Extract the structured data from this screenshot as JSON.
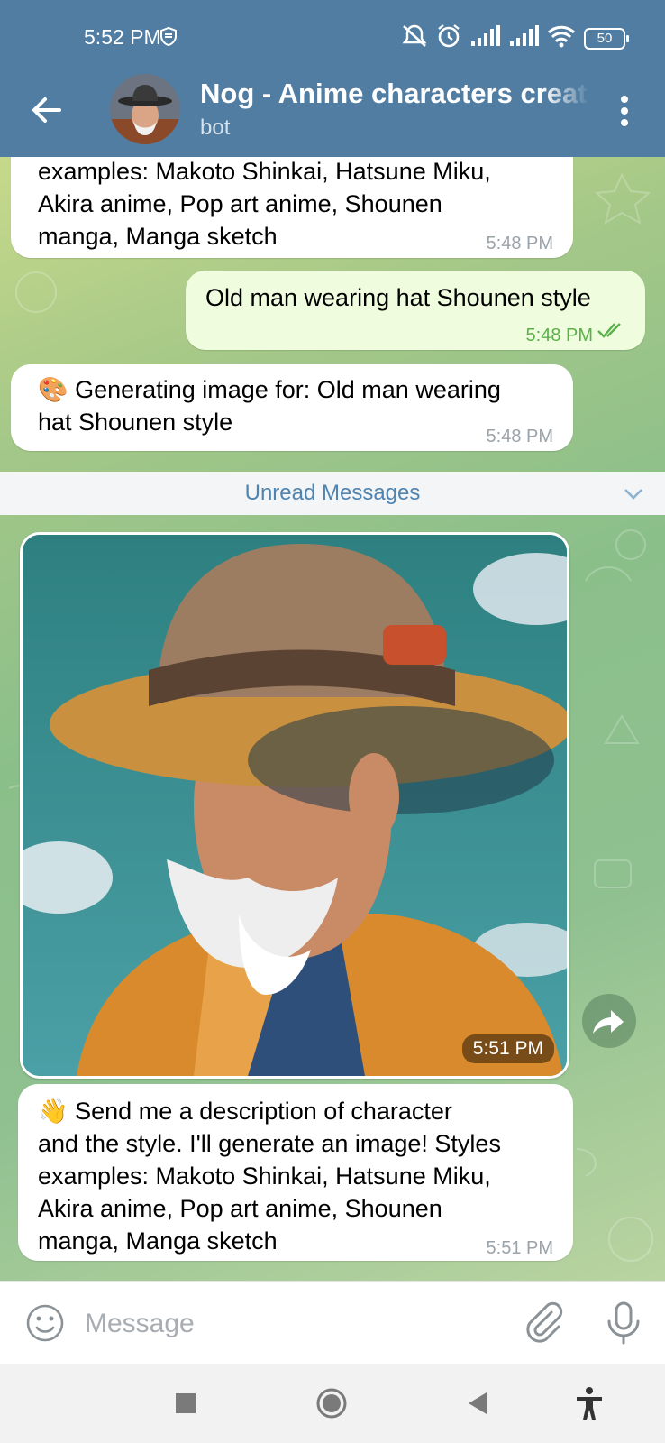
{
  "status_bar": {
    "time": "5:52 PM",
    "battery": "50"
  },
  "header": {
    "title": "Nog - Anime characters creator",
    "subtitle": "bot"
  },
  "messages": [
    {
      "lines": [
        "examples: Makoto Shinkai, Hatsune Miku,",
        "Akira anime, Pop art anime, Shounen",
        "manga, Manga sketch"
      ],
      "time": "5:48 PM"
    },
    {
      "text": "Old man wearing hat Shounen style",
      "time": "5:48 PM"
    },
    {
      "emoji": "🎨",
      "lines": [
        "Generating image for: Old man wearing",
        "hat Shounen style"
      ],
      "time": "5:48 PM"
    }
  ],
  "unread_label": "Unread Messages",
  "photo_message": {
    "time": "5:51 PM"
  },
  "last_message": {
    "emoji": "👋",
    "lines": [
      "Send me a description of character",
      "and the style. I'll generate an image! Styles",
      "examples: Makoto Shinkai, Hatsune Miku,",
      "Akira anime, Pop art anime, Shounen",
      "manga, Manga sketch"
    ],
    "time": "5:51 PM"
  },
  "input": {
    "placeholder": "Message"
  },
  "colors": {
    "header": "#517da2",
    "incoming_bubble": "#ffffff",
    "outgoing_bubble": "#effdde",
    "accent": "#4f84b0"
  },
  "icons": [
    "back-arrow-icon",
    "more-vert-icon",
    "emoji-icon",
    "paperclip-icon",
    "microphone-icon",
    "share-arrow-icon",
    "read-check-icon",
    "chevron-down-icon"
  ]
}
